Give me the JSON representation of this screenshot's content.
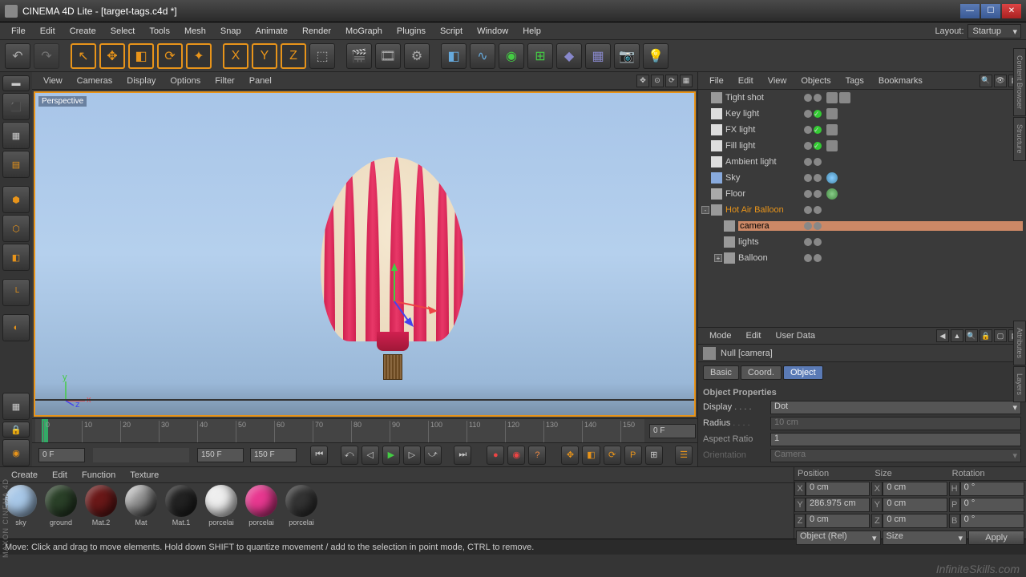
{
  "title": "CINEMA 4D Lite - [target-tags.c4d *]",
  "menubar": [
    "File",
    "Edit",
    "Create",
    "Select",
    "Tools",
    "Mesh",
    "Snap",
    "Animate",
    "Render",
    "MoGraph",
    "Plugins",
    "Script",
    "Window",
    "Help"
  ],
  "layout_label": "Layout:",
  "layout_value": "Startup",
  "viewport_menu": [
    "View",
    "Cameras",
    "Display",
    "Options",
    "Filter",
    "Panel"
  ],
  "viewport_label": "Perspective",
  "timeline": {
    "start": "0 F",
    "range_end": "150 F",
    "current": "150 F",
    "end": "0 F",
    "ticks": [
      0,
      10,
      20,
      30,
      40,
      50,
      60,
      70,
      80,
      90,
      100,
      110,
      120,
      130,
      140,
      150
    ]
  },
  "obj_mgr_menu": [
    "File",
    "Edit",
    "View",
    "Objects",
    "Tags",
    "Bookmarks"
  ],
  "objects": [
    {
      "name": "Tight shot",
      "indent": 0,
      "icon": "camera",
      "vis": [
        "gray",
        "gray"
      ],
      "tags": [
        "target",
        "whitebox"
      ]
    },
    {
      "name": "Key light",
      "indent": 0,
      "icon": "light",
      "vis": [
        "gray",
        "green"
      ],
      "tags": [
        "target"
      ]
    },
    {
      "name": "FX light",
      "indent": 0,
      "icon": "light",
      "vis": [
        "gray",
        "green"
      ],
      "tags": [
        "target"
      ]
    },
    {
      "name": "Fill light",
      "indent": 0,
      "icon": "light",
      "vis": [
        "gray",
        "green"
      ],
      "tags": [
        "target"
      ]
    },
    {
      "name": "Ambient light",
      "indent": 0,
      "icon": "light",
      "vis": [
        "gray",
        "gray"
      ],
      "tags": []
    },
    {
      "name": "Sky",
      "indent": 0,
      "icon": "sky",
      "vis": [
        "gray",
        "gray"
      ],
      "tags": [
        "sphere-blue"
      ]
    },
    {
      "name": "Floor",
      "indent": 0,
      "icon": "floor",
      "vis": [
        "gray",
        "gray"
      ],
      "tags": [
        "sphere-green"
      ]
    },
    {
      "name": "Hot Air Balloon",
      "indent": 0,
      "icon": "null",
      "vis": [
        "gray",
        "gray"
      ],
      "tags": [],
      "exp": "-",
      "sel": true
    },
    {
      "name": "camera",
      "indent": 1,
      "icon": "null",
      "vis": [
        "gray",
        "gray"
      ],
      "tags": [],
      "hl": true
    },
    {
      "name": "lights",
      "indent": 1,
      "icon": "null",
      "vis": [
        "gray",
        "gray"
      ],
      "tags": []
    },
    {
      "name": "Balloon",
      "indent": 1,
      "icon": "null",
      "vis": [
        "gray",
        "gray"
      ],
      "tags": [],
      "exp": "+"
    }
  ],
  "attr_menu": [
    "Mode",
    "Edit",
    "User Data"
  ],
  "attr_header": "Null [camera]",
  "attr_tabs": [
    "Basic",
    "Coord.",
    "Object"
  ],
  "attr_active_tab": 2,
  "obj_props_h": "Object Properties",
  "props": {
    "display_label": "Display",
    "display_val": "Dot",
    "radius_label": "Radius",
    "radius_val": "10 cm",
    "aspect_label": "Aspect Ratio",
    "aspect_val": "1",
    "orient_label": "Orientation",
    "orient_val": "Camera"
  },
  "mat_menu": [
    "Create",
    "Edit",
    "Function",
    "Texture"
  ],
  "materials": [
    {
      "name": "sky",
      "color": "#a8c8e8"
    },
    {
      "name": "ground",
      "color": "#2a4028"
    },
    {
      "name": "Mat.2",
      "color": "#6a1818"
    },
    {
      "name": "Mat",
      "color": "linear-gradient(135deg,#ddd,#888,#444)"
    },
    {
      "name": "Mat.1",
      "color": "#222"
    },
    {
      "name": "porcelai",
      "color": "#eee"
    },
    {
      "name": "porcelai",
      "color": "#e83890"
    },
    {
      "name": "porcelai",
      "color": "#333"
    }
  ],
  "coord": {
    "headers": [
      "Position",
      "Size",
      "Rotation"
    ],
    "rows": [
      {
        "l1": "X",
        "v1": "0 cm",
        "l2": "X",
        "v2": "0 cm",
        "l3": "H",
        "v3": "0 °"
      },
      {
        "l1": "Y",
        "v1": "286.975 cm",
        "l2": "Y",
        "v2": "0 cm",
        "l3": "P",
        "v3": "0 °"
      },
      {
        "l1": "Z",
        "v1": "0 cm",
        "l2": "Z",
        "v2": "0 cm",
        "l3": "B",
        "v3": "0 °"
      }
    ],
    "mode": "Object (Rel)",
    "size_mode": "Size",
    "apply": "Apply"
  },
  "status": "Move: Click and drag to move elements. Hold down SHIFT to quantize movement / add to the selection in point mode, CTRL to remove.",
  "watermark": "InfiniteSkills.com",
  "maxon": "MAXON CINEMA 4D"
}
